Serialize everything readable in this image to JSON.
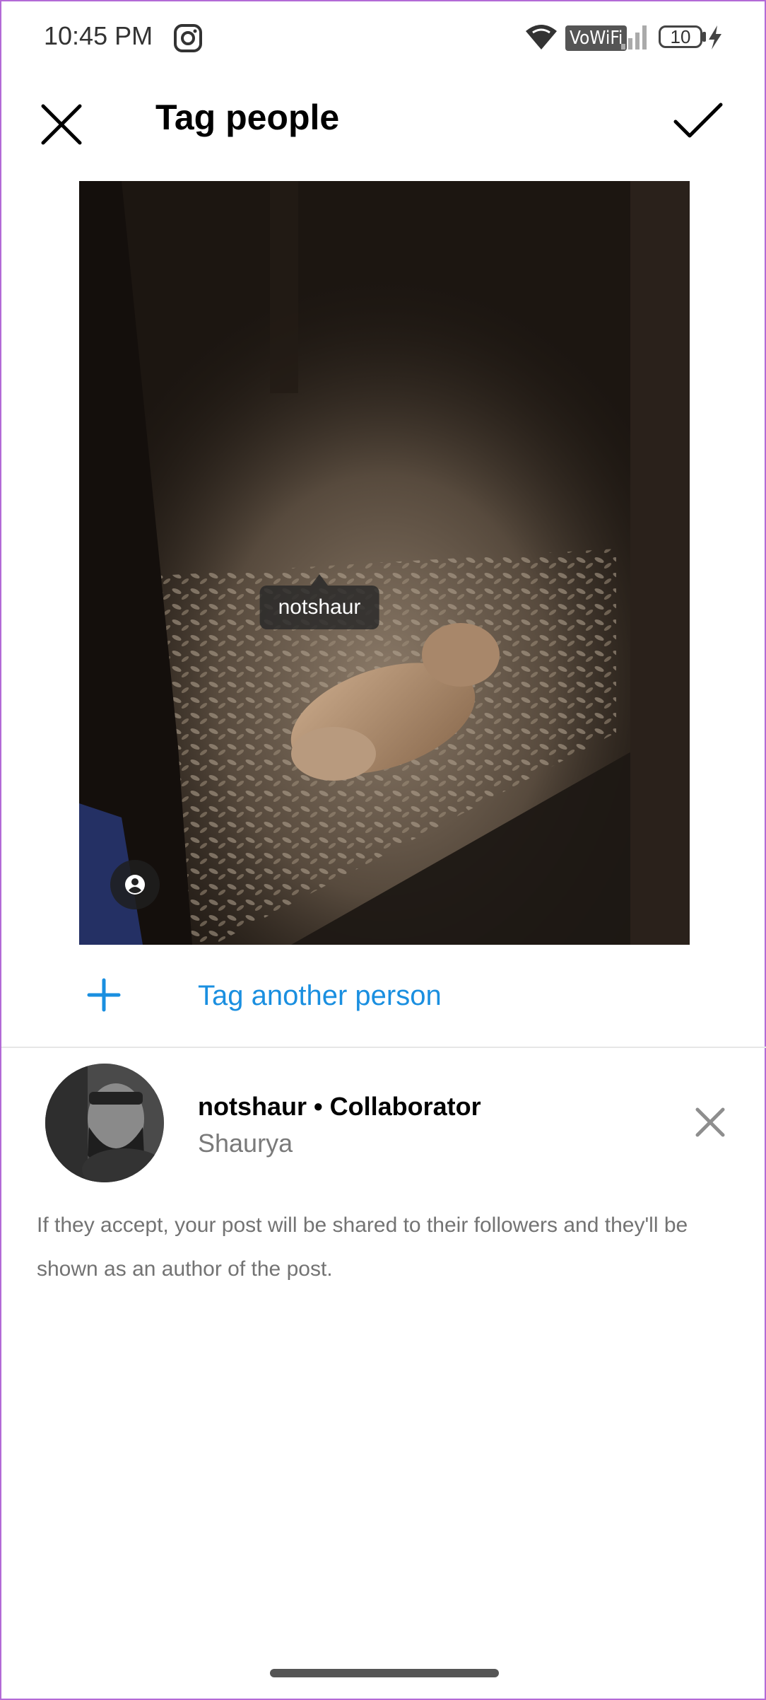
{
  "status_bar": {
    "time": "10:45 PM",
    "vowifi": "VoWiFi",
    "battery": "10",
    "icons": [
      "instagram-icon",
      "wifi-icon",
      "signal-icon",
      "battery-icon",
      "charging-icon"
    ]
  },
  "header": {
    "title": "Tag people",
    "close_icon": "close-icon",
    "done_icon": "checkmark-icon"
  },
  "photo": {
    "tag_label": "notshaur",
    "tag_icon": "person-icon"
  },
  "tag_another": {
    "label": "Tag another person",
    "icon": "plus-icon"
  },
  "tagged_user": {
    "username_line": "notshaur • Collaborator",
    "full_name": "Shaurya",
    "remove_icon": "close-icon"
  },
  "info_text": "If they accept, your post will be shared to their followers and they'll be shown as an author of the post.",
  "colors": {
    "accent": "#1a8fe0",
    "secondary_text": "#737373"
  }
}
